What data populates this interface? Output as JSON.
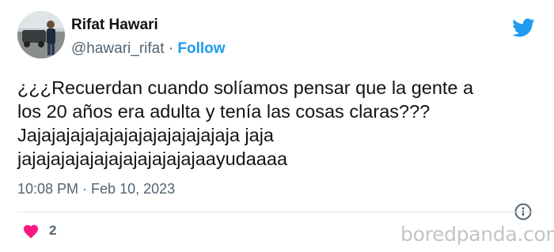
{
  "author": {
    "name": "Rifat Hawari",
    "handle": "@hawari_rifat",
    "separator": " · ",
    "follow_label": "Follow"
  },
  "tweet": {
    "lines": [
      "¿¿¿Recuerdan cuando solíamos pensar que la gente a",
      "los 20 años era adulta y tenía las cosas claras???",
      "Jajajajajajajajajajajajajajaja jaja",
      "jajajajajajajajajajajajajaayudaaaa"
    ],
    "time": "10:08 PM",
    "date_separator": " · ",
    "date": "Feb 10, 2023",
    "like_count": "2"
  },
  "icons": {
    "brand": "twitter-bird-icon",
    "info": "info-icon",
    "like": "heart-icon"
  },
  "colors": {
    "accent": "#1d9bf0",
    "heart": "#f91880",
    "secondary_text": "#536471"
  },
  "watermark": "boredpanda.com"
}
